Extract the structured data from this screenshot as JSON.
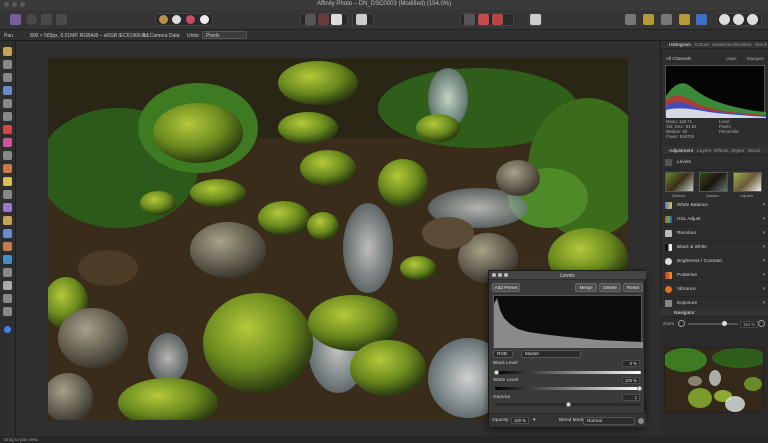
{
  "window": {
    "title": "Affinity Photo – DN_DSC0003 (Modified) (154.0%)"
  },
  "context_bar": {
    "tool": "Pan",
    "doc_info": "800 × 583px, 0.51MP, RGBA/8 – sRGB IEC61966-2.1",
    "camera": "No Camera Data",
    "units_label": "Units:",
    "units_value": "Pixels"
  },
  "histogram_panel": {
    "tabs": [
      "Histogram",
      "Colour",
      "Swatches",
      "Brushes",
      "Stock"
    ],
    "channel": "All Channels",
    "layer_label": "Layer",
    "marquee_label": "Marquee",
    "stats_left": [
      "Mean: 118.71",
      "Std. Dev.: 81.84",
      "Median: 92",
      "Pixels: 926700"
    ],
    "stats_right": [
      "Level:",
      "Pixels:",
      "Percentile:"
    ]
  },
  "adjustment_panel": {
    "tabs": [
      "Adjustment",
      "Layers",
      "Effects",
      "Styles",
      "Stock"
    ],
    "levels_title": "Levels",
    "presets": [
      "Default",
      "Darken",
      "Lighten"
    ],
    "items": [
      "White Balance",
      "HSL Adjust",
      "Recolour",
      "Black & White",
      "Brightness / Contrast",
      "Posterise",
      "Vibrance",
      "Exposure"
    ]
  },
  "navigator": {
    "tab": "Navigator",
    "zoom_label": "Zoom",
    "zoom_value": "154 %"
  },
  "levels_dialog": {
    "title": "Levels",
    "add_preset": "Add Preset",
    "merge": "Merge",
    "delete": "Delete",
    "reset": "Reset",
    "channel": "RGB",
    "mode": "Master",
    "black_label": "Black Level",
    "black_value": "0 %",
    "white_label": "White Level",
    "white_value": "100 %",
    "gamma_label": "Gamma",
    "gamma_value": "1",
    "gamma_fraction": 0.5,
    "opacity_label": "Opacity:",
    "opacity_value": "100 %",
    "blend_label": "Blend Mode:",
    "blend_value": "Normal"
  },
  "status": {
    "text": "Drag to pan view."
  },
  "colors": {
    "accent": "#3b82f6",
    "panel": "#2d2d2d",
    "toolbar": "#353535"
  }
}
